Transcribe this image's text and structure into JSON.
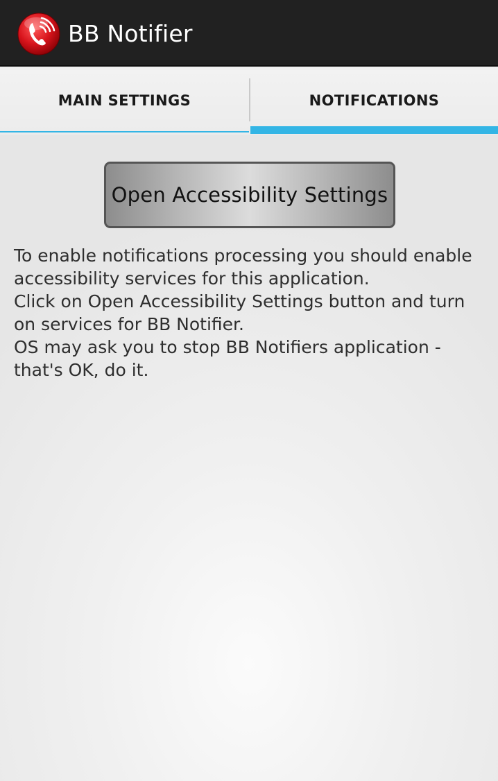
{
  "action_bar": {
    "icon": "phone-alert-icon",
    "title": "BB Notifier"
  },
  "tabs": [
    {
      "label": "MAIN SETTINGS",
      "selected": false
    },
    {
      "label": "NOTIFICATIONS",
      "selected": true
    }
  ],
  "notifications": {
    "open_button_label": "Open Accessibility Settings",
    "description_lines": [
      "To enable notifications processing you should enable",
      "accessibility services for this application.",
      "Click on Open Accessibility Settings button and turn",
      "on services for BB Notifier.",
      "OS may ask you to stop BB Notifiers application -",
      "that's OK, do it."
    ]
  },
  "colors": {
    "action_bar_bg": "#212121",
    "tab_indicator": "#33b5e5",
    "icon_red": "#d8141c"
  }
}
